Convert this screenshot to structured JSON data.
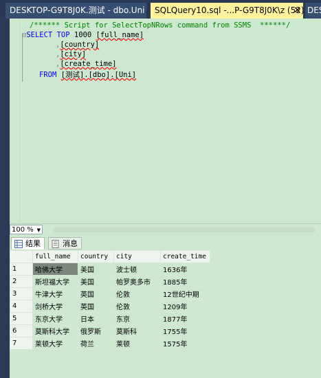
{
  "tabs": [
    {
      "label": "DESKTOP-G9T8J0K.测试 - dbo.Uni",
      "active": false
    },
    {
      "label": "SQLQuery10.sql -...P-G9T8J0K\\z (52))",
      "active": true,
      "close": "✕"
    },
    {
      "label": "DESK",
      "active": false
    }
  ],
  "editor": {
    "comment": "/****** Script for SelectTopNRows command from SSMS  ******/",
    "select_kw": "SELECT",
    "top_kw": "TOP",
    "top_num": "1000",
    "col1": "[full_name]",
    "col2": "[country]",
    "col3": "[city]",
    "col4": "[create_time]",
    "comma": ",",
    "from_kw": "FROM",
    "from_obj": "[测试].[dbo].[Uni]"
  },
  "zoom": {
    "value": "100 %"
  },
  "result_tabs": [
    {
      "label": "结果",
      "icon": "grid-icon"
    },
    {
      "label": "消息",
      "icon": "message-icon"
    }
  ],
  "grid": {
    "columns": [
      "full_name",
      "country",
      "city",
      "create_time"
    ],
    "rows": [
      {
        "n": "1",
        "cells": [
          "哈佛大学",
          "美国",
          "波士顿",
          "1636年"
        ]
      },
      {
        "n": "2",
        "cells": [
          "斯坦福大学",
          "美国",
          "帕罗奥多市",
          "1885年"
        ]
      },
      {
        "n": "3",
        "cells": [
          "牛津大学",
          "英国",
          "伦敦",
          "12世纪中期"
        ]
      },
      {
        "n": "4",
        "cells": [
          "剑桥大学",
          "英国",
          "伦敦",
          "1209年"
        ]
      },
      {
        "n": "5",
        "cells": [
          "东京大学",
          "日本",
          "东京",
          "1877年"
        ]
      },
      {
        "n": "6",
        "cells": [
          "莫斯科大学",
          "俄罗斯",
          "莫斯科",
          "1755年"
        ]
      },
      {
        "n": "7",
        "cells": [
          "莱顿大学",
          "荷兰",
          "莱顿",
          "1575年"
        ]
      }
    ]
  }
}
